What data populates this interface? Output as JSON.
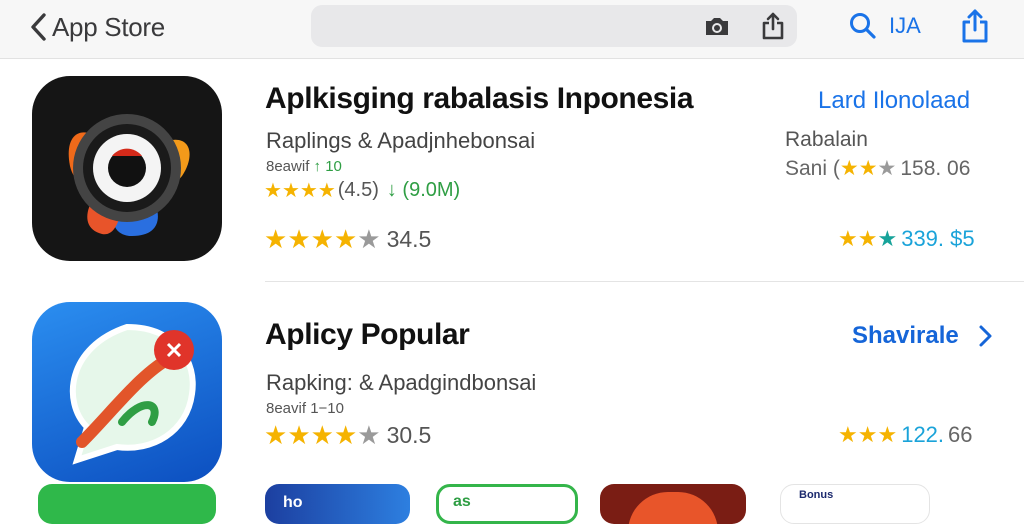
{
  "nav": {
    "back_label": "App Store",
    "top_text": "IJA"
  },
  "apps": [
    {
      "title": "Aplkisging rabalasis Inponesia",
      "subtitle": "Raplings & Apadjnhebonsai",
      "tiny_a": "8eawif",
      "tiny_b": "↑ 10",
      "rating_value": "(4.5)",
      "downloads": "↓ (9.0M)",
      "score": "34.5",
      "action": "Lard Ilonolaad",
      "meta_label": "Rabalain",
      "meta_prefix": "Sani (",
      "meta_value": "158. 06",
      "price": "339. $5"
    },
    {
      "title": "Aplicy Popular",
      "subtitle": "Rapking: & Apadgindbonsai",
      "tiny": "8eavif 1−10",
      "score": "30.5",
      "action": "Shavirale",
      "price_value": "122.",
      "price_suffix": "66"
    }
  ],
  "bottom_tiles": [
    {
      "label": "ho"
    },
    {
      "label": "as"
    },
    {
      "label": ""
    },
    {
      "label": "Bonus"
    }
  ],
  "colors": {
    "accent": "#1a73e8",
    "star": "#f5b301",
    "green": "#2f9e44",
    "teal": "#17a39a"
  },
  "icons": [
    "chevron-left-icon",
    "camera-icon",
    "share-icon",
    "search-icon",
    "upload-icon",
    "chevron-right-icon",
    "star-icon"
  ]
}
